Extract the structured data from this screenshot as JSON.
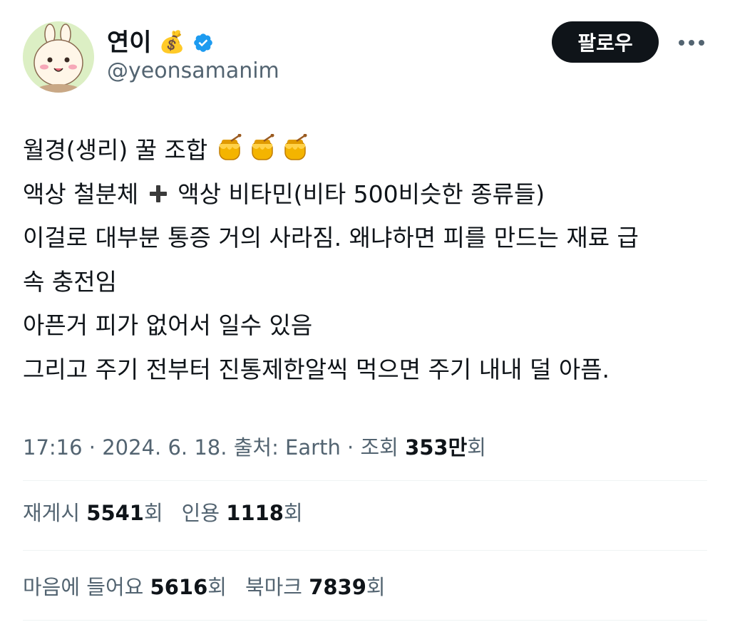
{
  "profile": {
    "display_name": "연이",
    "name_emoji": "💰",
    "handle": "@yeonsamanim",
    "verified_icon": "verified-badge-icon",
    "avatar_icon": "avatar-illustration"
  },
  "actions": {
    "follow_label": "팔로우",
    "more_icon": "more-dots-icon"
  },
  "tweet": {
    "line1_text": "월경(생리) 꿀 조합",
    "line1_emoji": "honey-pot-icon",
    "line2_a": "액상 철분체",
    "line2_b": "액상 비타민(비타 500비슷한 종류들)",
    "line3": "이걸로 대부분 통증 거의 사라짐. 왜냐하면 피를 만드는 재료 급",
    "line4": "속 충전임",
    "line5": "아픈거 피가 없어서 일수 있음",
    "line6": "그리고 주기 전부터 진통제한알씩 먹으면 주기 내내 덜 아픔."
  },
  "meta": {
    "time": "17:16",
    "sep1": " · ",
    "date": "2024. 6. 18.",
    "sep2": " ",
    "source": "출처: Earth",
    "sep3": " · ",
    "views_label": "조회 ",
    "views_count": "353만",
    "views_suffix": "회"
  },
  "stats": {
    "reposts_label": "재게시 ",
    "reposts_count": "5541",
    "reposts_suffix": "회",
    "quotes_label": "인용 ",
    "quotes_count": "1118",
    "quotes_suffix": "회",
    "likes_label": "마음에 들어요 ",
    "likes_count": "5616",
    "likes_suffix": "회",
    "bookmarks_label": "북마크 ",
    "bookmarks_count": "7839",
    "bookmarks_suffix": "회"
  },
  "colors": {
    "text_primary": "#0f1419",
    "text_secondary": "#536471",
    "verified_blue": "#1d9bf0",
    "button_dark": "#0f1419",
    "divider": "#eff3f4",
    "honey_gold": "#f4b400"
  }
}
